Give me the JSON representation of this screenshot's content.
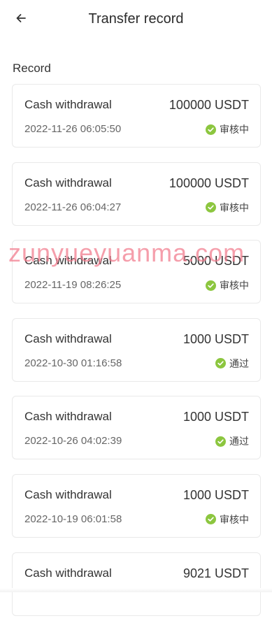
{
  "header": {
    "title": "Transfer record",
    "back_icon": "arrow-left-icon"
  },
  "section": {
    "label": "Record"
  },
  "colors": {
    "status_green": "#8cc63f",
    "watermark": "#f27a8c"
  },
  "records": [
    {
      "type": "Cash withdrawal",
      "amount": "100000 USDT",
      "date": "2022-11-26 06:05:50",
      "status": "审核中"
    },
    {
      "type": "Cash withdrawal",
      "amount": "100000 USDT",
      "date": "2022-11-26 06:04:27",
      "status": "审核中"
    },
    {
      "type": "Cash withdrawal",
      "amount": "5000 USDT",
      "date": "2022-11-19 08:26:25",
      "status": "审核中"
    },
    {
      "type": "Cash withdrawal",
      "amount": "1000 USDT",
      "date": "2022-10-30 01:16:58",
      "status": "通过"
    },
    {
      "type": "Cash withdrawal",
      "amount": "1000 USDT",
      "date": "2022-10-26 04:02:39",
      "status": "通过"
    },
    {
      "type": "Cash withdrawal",
      "amount": "1000 USDT",
      "date": "2022-10-19 06:01:58",
      "status": "审核中"
    },
    {
      "type": "Cash withdrawal",
      "amount": "9021 USDT",
      "date": "",
      "status": ""
    }
  ],
  "watermark": {
    "text": "zunyueyuanma.com"
  }
}
